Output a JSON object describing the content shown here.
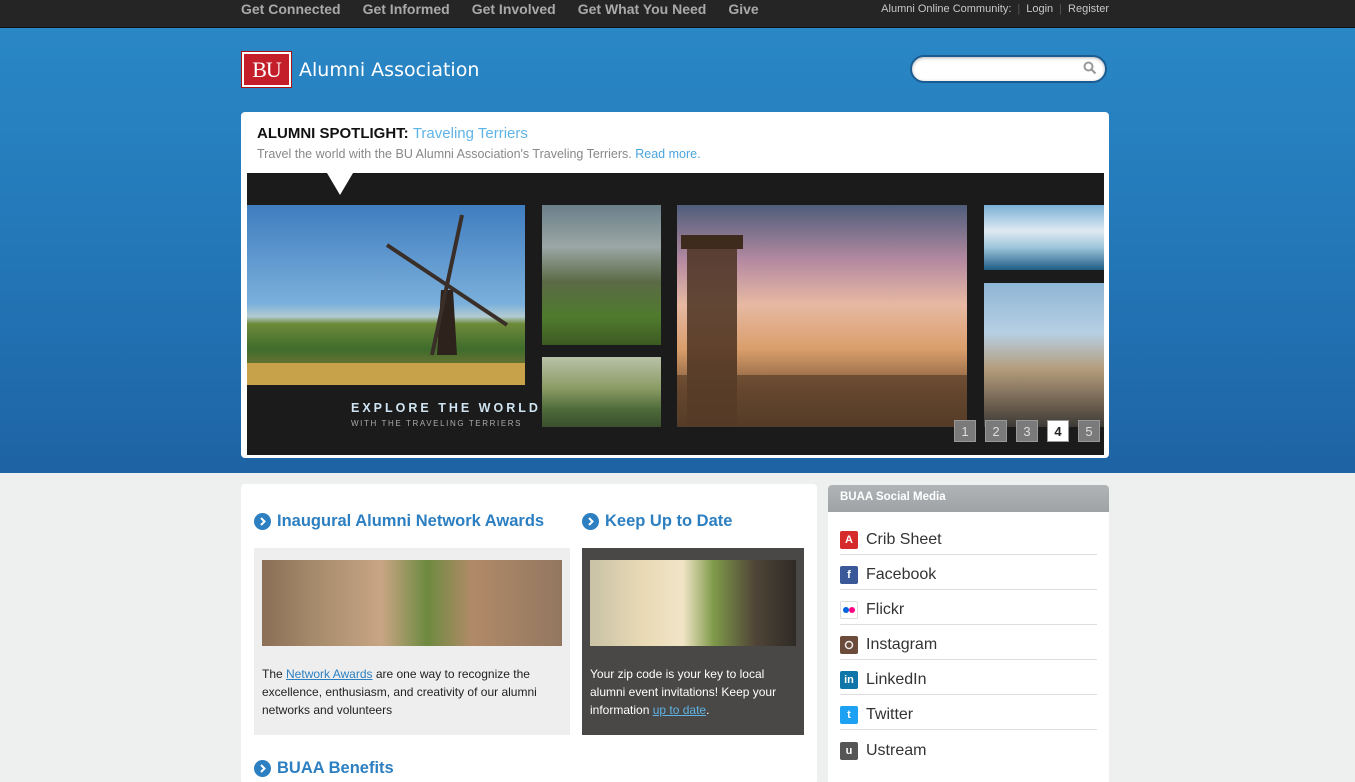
{
  "topnav": {
    "items": [
      "Get Connected",
      "Get Informed",
      "Get Involved",
      "Get What You Need",
      "Give"
    ],
    "community_label": "Alumni Online Community:",
    "login": "Login",
    "register": "Register"
  },
  "header": {
    "logo_mark": "BU",
    "logo_text": "Alumni Association",
    "search_placeholder": ""
  },
  "spotlight": {
    "label": "ALUMNI SPOTLIGHT:",
    "title": "Traveling Terriers",
    "subtitle": "Travel the world with the BU Alumni Association's Traveling Terriers.",
    "read_more": "Read more.",
    "banner_line1": "EXPLORE THE WORLD",
    "banner_line2": "WITH THE TRAVELING TERRIERS",
    "pages": [
      "1",
      "2",
      "3",
      "4",
      "5"
    ],
    "active_page": "4"
  },
  "sections": {
    "awards": {
      "title": "Inaugural Alumni Network Awards",
      "text_before": "The ",
      "link": "Network Awards",
      "text_after": " are one way to recognize the excellence, enthusiasm, and creativity of our alumni networks and volunteers"
    },
    "uptodate": {
      "title": "Keep Up to Date",
      "text_before": "Your zip code is your key to local alumni event invitations! Keep your information ",
      "link": "up to date",
      "text_after": "."
    },
    "benefits": {
      "title": "BUAA Benefits"
    }
  },
  "social": {
    "title": "BUAA Social Media",
    "items": [
      {
        "label": "Crib Sheet",
        "icon": "app-icon",
        "color": "#d62b2b"
      },
      {
        "label": "Facebook",
        "icon": "facebook-icon",
        "color": "#3b5998"
      },
      {
        "label": "Flickr",
        "icon": "flickr-icon",
        "color": "#ffffff"
      },
      {
        "label": "Instagram",
        "icon": "instagram-icon",
        "color": "#6b4b3a"
      },
      {
        "label": "LinkedIn",
        "icon": "linkedin-icon",
        "color": "#0e76a8"
      },
      {
        "label": "Twitter",
        "icon": "twitter-icon",
        "color": "#1da1f2"
      },
      {
        "label": "Ustream",
        "icon": "ustream-icon",
        "color": "#555555"
      }
    ]
  }
}
